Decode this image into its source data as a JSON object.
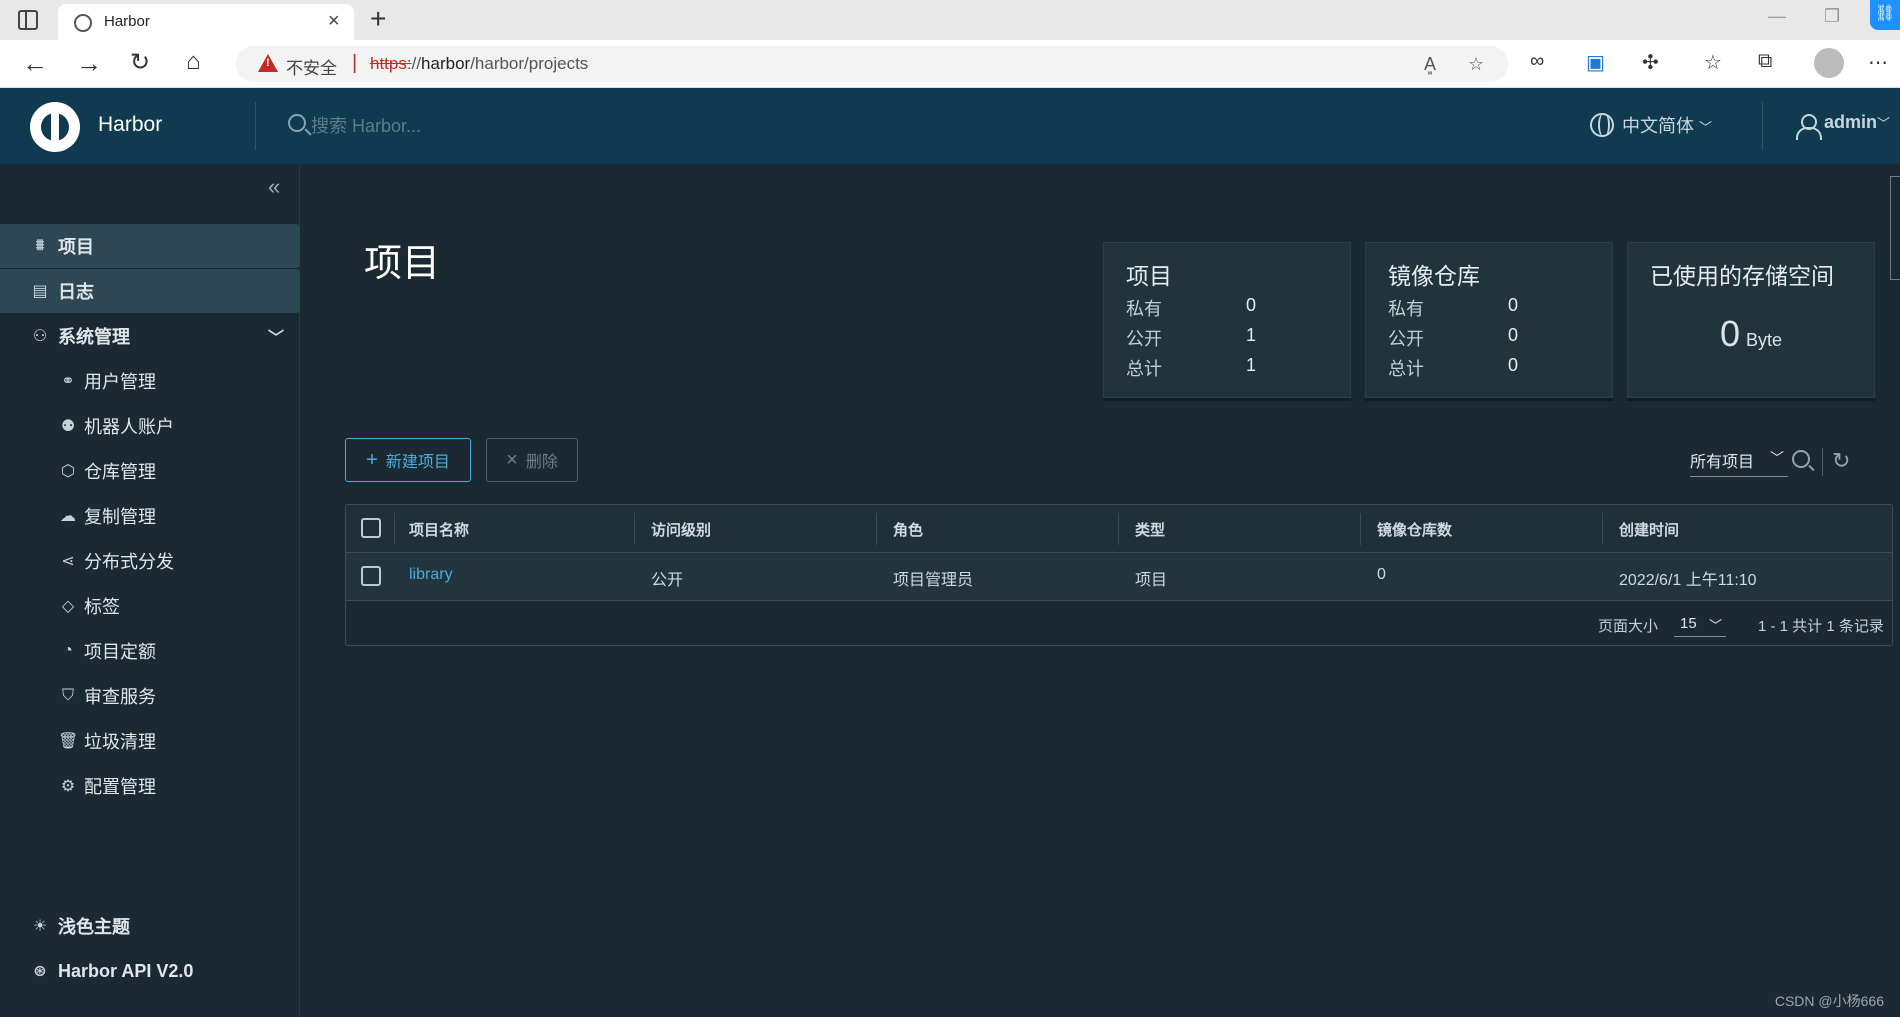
{
  "browser": {
    "tab_title": "Harbor",
    "insecure_label": "不安全",
    "url_scheme": "https:",
    "url_rest_prefix": "//",
    "url_host": "harbor",
    "url_path": "/harbor/projects"
  },
  "header": {
    "brand": "Harbor",
    "search_placeholder": "搜索 Harbor...",
    "language": "中文简体",
    "user": "admin"
  },
  "sidebar": {
    "items": [
      {
        "label": "项目",
        "icon": "projects-icon",
        "active": true
      },
      {
        "label": "日志",
        "icon": "logs-icon",
        "active": true
      },
      {
        "label": "系统管理",
        "icon": "admin-icon",
        "active": false
      }
    ],
    "sub_items": [
      {
        "label": "用户管理",
        "icon": "users-icon"
      },
      {
        "label": "机器人账户",
        "icon": "robot-icon"
      },
      {
        "label": "仓库管理",
        "icon": "registry-icon"
      },
      {
        "label": "复制管理",
        "icon": "replication-icon"
      },
      {
        "label": "分布式分发",
        "icon": "distribution-icon"
      },
      {
        "label": "标签",
        "icon": "tag-icon"
      },
      {
        "label": "项目定额",
        "icon": "quota-icon"
      },
      {
        "label": "审查服务",
        "icon": "shield-icon"
      },
      {
        "label": "垃圾清理",
        "icon": "trash-icon"
      },
      {
        "label": "配置管理",
        "icon": "gear-icon"
      }
    ],
    "bottom": [
      {
        "label": "浅色主题",
        "icon": "sun-icon"
      },
      {
        "label": "Harbor API V2.0",
        "icon": "api-icon"
      }
    ]
  },
  "main": {
    "title": "项目",
    "cards": [
      {
        "title": "项目",
        "rows": [
          {
            "label": "私有",
            "value": "0"
          },
          {
            "label": "公开",
            "value": "1"
          },
          {
            "label": "总计",
            "value": "1"
          }
        ]
      },
      {
        "title": "镜像仓库",
        "rows": [
          {
            "label": "私有",
            "value": "0"
          },
          {
            "label": "公开",
            "value": "0"
          },
          {
            "label": "总计",
            "value": "0"
          }
        ]
      }
    ],
    "storage": {
      "title": "已使用的存储空间",
      "value": "0",
      "unit": "Byte"
    },
    "buttons": {
      "new_project": "新建项目",
      "delete": "删除"
    },
    "filter": "所有项目",
    "table": {
      "headers": [
        "项目名称",
        "访问级别",
        "角色",
        "类型",
        "镜像仓库数",
        "创建时间"
      ],
      "rows": [
        [
          "library",
          "公开",
          "项目管理员",
          "项目",
          "0",
          "2022/6/1 上午11:10"
        ]
      ]
    },
    "pagination": {
      "page_size_label": "页面大小",
      "page_size": "15",
      "info": "1 - 1 共计 1 条记录"
    }
  },
  "watermark": "CSDN @小杨666"
}
